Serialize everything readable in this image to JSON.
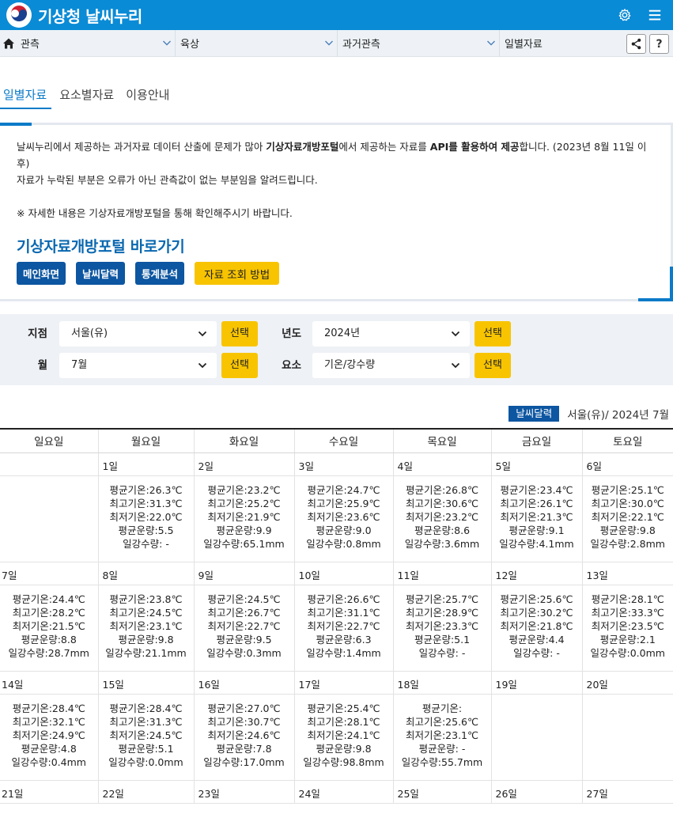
{
  "header": {
    "title": "기상청 날씨누리"
  },
  "breadcrumb": {
    "items": [
      "관측",
      "육상",
      "과거관측",
      "일별자료"
    ],
    "help_label": "?"
  },
  "tabs": [
    {
      "label": "일별자료",
      "active": true
    },
    {
      "label": "요소별자료",
      "active": false
    },
    {
      "label": "이용안내",
      "active": false
    }
  ],
  "notice": {
    "line1_a": "날씨누리에서 제공하는 과거자료 데이터 산출에 문제가 많아 ",
    "line1_b": "기상자료개방포털",
    "line1_c": "에서 제공하는 자료를 ",
    "line1_d": "API를 활용하여 제공",
    "line1_e": "합니다. (2023년 8월 11일 이후)",
    "line2": "자료가 누락된 부분은 오류가 아닌 관측값이 없는 부분임을 알려드립니다.",
    "note": "※ 자세한 내용은 기상자료개방포털을 통해 확인해주시기 바랍니다.",
    "portal_link": "기상자료개방포털 바로가기",
    "buttons": [
      "메인화면",
      "날씨달력",
      "통계분석"
    ],
    "howto_button": "자료 조회 방법"
  },
  "filters": {
    "station_label": "지점",
    "station_value": "서울(유)",
    "year_label": "년도",
    "year_value": "2024년",
    "month_label": "월",
    "month_value": "7월",
    "element_label": "요소",
    "element_value": "기온/강수량",
    "select_label": "선택"
  },
  "calendar": {
    "badge": "날씨달력",
    "caption": "서울(유)/ 2024년 7월",
    "weekdays": [
      "일요일",
      "월요일",
      "화요일",
      "수요일",
      "목요일",
      "금요일",
      "토요일"
    ],
    "weeks": [
      {
        "days": [
          "",
          "1일",
          "2일",
          "3일",
          "4일",
          "5일",
          "6일"
        ],
        "data": [
          [],
          [
            "평균기온:26.3℃",
            "최고기온:31.3℃",
            "최저기온:22.0℃",
            "평균운량:5.5",
            "일강수량: -"
          ],
          [
            "평균기온:23.2℃",
            "최고기온:25.2℃",
            "최저기온:21.9℃",
            "평균운량:9.9",
            "일강수량:65.1mm"
          ],
          [
            "평균기온:24.7℃",
            "최고기온:25.9℃",
            "최저기온:23.6℃",
            "평균운량:9.0",
            "일강수량:0.8mm"
          ],
          [
            "평균기온:26.8℃",
            "최고기온:30.6℃",
            "최저기온:23.2℃",
            "평균운량:8.6",
            "일강수량:3.6mm"
          ],
          [
            "평균기온:23.4℃",
            "최고기온:26.1℃",
            "최저기온:21.3℃",
            "평균운량:9.1",
            "일강수량:4.1mm"
          ],
          [
            "평균기온:25.1℃",
            "최고기온:30.0℃",
            "최저기온:22.1℃",
            "평균운량:9.8",
            "일강수량:2.8mm"
          ]
        ]
      },
      {
        "days": [
          "7일",
          "8일",
          "9일",
          "10일",
          "11일",
          "12일",
          "13일"
        ],
        "data": [
          [
            "평균기온:24.4℃",
            "최고기온:28.2℃",
            "최저기온:21.5℃",
            "평균운량:8.8",
            "일강수량:28.7mm"
          ],
          [
            "평균기온:23.8℃",
            "최고기온:24.5℃",
            "최저기온:23.1℃",
            "평균운량:9.8",
            "일강수량:21.1mm"
          ],
          [
            "평균기온:24.5℃",
            "최고기온:26.7℃",
            "최저기온:22.7℃",
            "평균운량:9.5",
            "일강수량:0.3mm"
          ],
          [
            "평균기온:26.6℃",
            "최고기온:31.1℃",
            "최저기온:22.7℃",
            "평균운량:6.3",
            "일강수량:1.4mm"
          ],
          [
            "평균기온:25.7℃",
            "최고기온:28.9℃",
            "최저기온:23.3℃",
            "평균운량:5.1",
            "일강수량: -"
          ],
          [
            "평균기온:25.6℃",
            "최고기온:30.2℃",
            "최저기온:21.8℃",
            "평균운량:4.4",
            "일강수량: -"
          ],
          [
            "평균기온:28.1℃",
            "최고기온:33.3℃",
            "최저기온:23.5℃",
            "평균운량:2.1",
            "일강수량:0.0mm"
          ]
        ]
      },
      {
        "days": [
          "14일",
          "15일",
          "16일",
          "17일",
          "18일",
          "19일",
          "20일"
        ],
        "data": [
          [
            "평균기온:28.4℃",
            "최고기온:32.1℃",
            "최저기온:24.9℃",
            "평균운량:4.8",
            "일강수량:0.4mm"
          ],
          [
            "평균기온:28.4℃",
            "최고기온:31.3℃",
            "최저기온:24.5℃",
            "평균운량:5.1",
            "일강수량:0.0mm"
          ],
          [
            "평균기온:27.0℃",
            "최고기온:30.7℃",
            "최저기온:24.6℃",
            "평균운량:7.8",
            "일강수량:17.0mm"
          ],
          [
            "평균기온:25.4℃",
            "최고기온:28.1℃",
            "최저기온:24.1℃",
            "평균운량:9.8",
            "일강수량:98.8mm"
          ],
          [
            "평균기온:",
            "최고기온:25.6℃",
            "최저기온:23.1℃",
            "평균운량: -",
            "일강수량:55.7mm"
          ],
          [],
          []
        ]
      },
      {
        "days": [
          "21일",
          "22일",
          "23일",
          "24일",
          "25일",
          "26일",
          "27일"
        ],
        "data": []
      }
    ]
  }
}
